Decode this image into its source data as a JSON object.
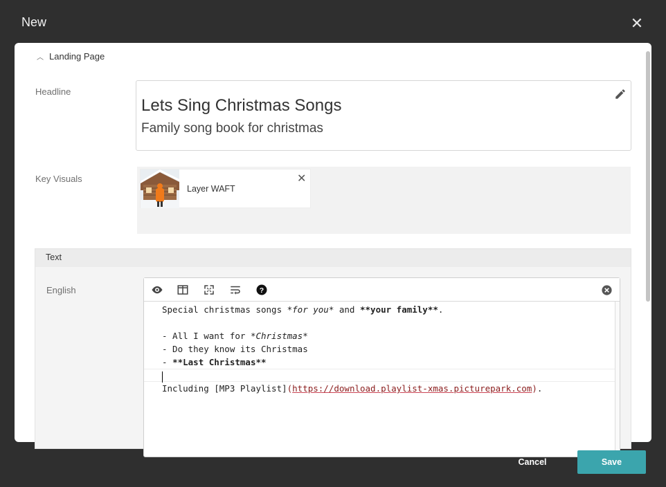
{
  "dialog": {
    "title": "New",
    "close_icon": "close-icon"
  },
  "section": {
    "label": "Landing Page",
    "icon": "chevron-up-icon"
  },
  "headline": {
    "label": "Headline",
    "title": "Lets Sing Christmas Songs",
    "subtitle": "Family song book for christmas",
    "edit_icon": "pencil-icon"
  },
  "key_visuals": {
    "label": "Key Visuals",
    "items": [
      {
        "name": "Layer WAFT",
        "thumb_icon": "image-thumbnail",
        "remove_icon": "close-icon"
      }
    ]
  },
  "text": {
    "section_title": "Text",
    "language_label": "English",
    "toolbar": [
      "eye-icon",
      "columns-icon",
      "fullscreen-icon",
      "wrap-icon",
      "help-icon"
    ],
    "clear_icon": "clear-circle-icon",
    "lines": {
      "l1_a": "Special christmas songs ",
      "l1_b": "*for you*",
      "l1_c": " and ",
      "l1_d": "**your family**",
      "l1_e": ".",
      "l3_a": "- All I want for ",
      "l3_b": "*Christmas*",
      "l4": "- Do they know its Christmas",
      "l5_a": "- ",
      "l5_b": "**Last Christmas**",
      "l7_a": "Including [MP3 Playlist]",
      "l7_b": "(",
      "l7_c": "https://download.playlist-xmas.picturepark.com",
      "l7_d": ")",
      "l7_e": "."
    }
  },
  "footer": {
    "cancel": "Cancel",
    "save": "Save"
  },
  "colors": {
    "backdrop": "#2f2f2f",
    "save_button": "#3ba5ad",
    "link": "#8a1c1c"
  }
}
